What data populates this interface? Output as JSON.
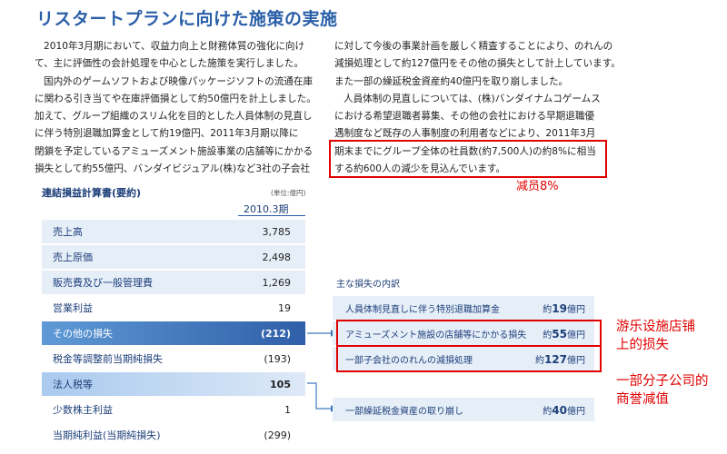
{
  "title": "リスタートプランに向けた施策の実施",
  "left_paragraph_lines": [
    "2010年3月期において、収益力向上と財務体質の強化に向け",
    "て、主に評価性の会計処理を中心とした施策を実行しました。",
    "国内外のゲームソフトおよび映像パッケージソフトの流通在庫",
    "に関わる引き当てや在庫評価損として約50億円を計上しました。",
    "加えて、グループ組織のスリム化を目的とした人員体制の見直し",
    "に伴う特別退職加算金として約19億円、2011年3月期以降に",
    "閉鎖を予定しているアミューズメント施設事業の店舗等にかかる",
    "損失として約55億円、バンダイビジュアル(株)など3社の子会社"
  ],
  "right_paragraph_lines": [
    "に対して今後の事業計画を厳しく精査することにより、のれんの",
    "減損処理として約127億円をその他の損失として計上しています。",
    "また一部の繰延税金資産約40億円を取り崩しました。",
    "人員体制の見直しについては、(株)バンダイナムコゲームス",
    "における希望退職者募集、その他の会社における早期退職優",
    "遇制度など既存の人事制度の利用者などにより、2011年3月",
    "期末までにグループ全体の社員数(約7,500人)の約8%に相当",
    "する約600人の減少を見込んでいます。"
  ],
  "annotations": {
    "staff_cut": "减员8%",
    "amusement_loss": [
      "游乐设施店铺",
      "上的损失"
    ],
    "goodwill_impairment": [
      "一部分子公司的",
      "商誉减值"
    ]
  },
  "table": {
    "title": "連結損益計算書(要約)",
    "unit": "(単位:億円)",
    "period": "2010.3期",
    "rows": [
      {
        "label": "売上高",
        "value": "3,785"
      },
      {
        "label": "売上原価",
        "value": "2,498"
      },
      {
        "label": "販売費及び一般管理費",
        "value": "1,269"
      },
      {
        "label": "営業利益",
        "value": "19"
      },
      {
        "label": "その他の損失",
        "value": "(212)"
      },
      {
        "label": "税金等調整前当期純損失",
        "value": "(193)"
      },
      {
        "label": "法人税等",
        "value": "105"
      },
      {
        "label": "少数株主利益",
        "value": "1"
      },
      {
        "label": "当期純利益(当期純損失)",
        "value": "(299)"
      }
    ]
  },
  "losses": {
    "title": "主な損失の内訳",
    "items": [
      {
        "label": "人員体制見直しに伴う特別退職加算金",
        "prefix": "約",
        "amount": "19",
        "unit": "億円"
      },
      {
        "label": "アミューズメント施設の店舗等にかかる損失",
        "prefix": "約",
        "amount": "55",
        "unit": "億円"
      },
      {
        "label": "一部子会社ののれんの減損処理",
        "prefix": "約",
        "amount": "127",
        "unit": "億円"
      },
      {
        "label": "一部繰延税金資産の取り崩し",
        "prefix": "約",
        "amount": "40",
        "unit": "億円"
      }
    ]
  },
  "colors": {
    "title_blue": "#2a5fa8",
    "highlight_red": "#e00000",
    "row_shade": "#e6eef8",
    "row_dark": "#2f5fa8"
  }
}
